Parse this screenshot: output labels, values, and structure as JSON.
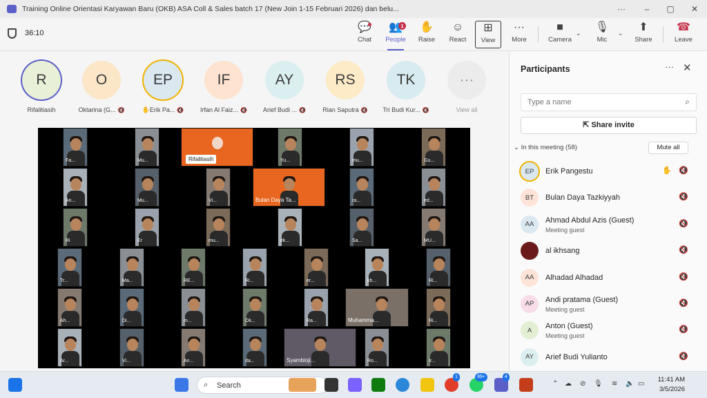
{
  "window": {
    "title": "Training Online Orientasi Karyawan Baru (OKB) ASA Coll & Sales batch 17 (New Join 1-15 Februari 2026) dan belu...",
    "more_label": "···",
    "minimize_label": "–",
    "maximize_label": "▢",
    "close_label": "✕"
  },
  "toolbar": {
    "timer": "36:10",
    "buttons": [
      {
        "label": "Chat",
        "icon": "chat-icon",
        "glyph": "💬"
      },
      {
        "label": "People",
        "icon": "people-icon",
        "glyph": "👥",
        "badge": "1"
      },
      {
        "label": "Raise",
        "icon": "hand-icon",
        "glyph": "✋"
      },
      {
        "label": "React",
        "icon": "smile-icon",
        "glyph": "☺"
      },
      {
        "label": "View",
        "icon": "grid-icon",
        "glyph": "⊞"
      },
      {
        "label": "More",
        "icon": "ellipsis-icon",
        "glyph": "···"
      },
      {
        "label": "Camera",
        "icon": "camera-icon",
        "glyph": "■"
      },
      {
        "label": "Mic",
        "icon": "mic-off-icon",
        "glyph": "🎙"
      },
      {
        "label": "Share",
        "icon": "share-icon",
        "glyph": "⬆"
      },
      {
        "label": "Leave",
        "icon": "phone-icon",
        "glyph": "☎"
      }
    ],
    "caret": "⌄"
  },
  "avatars": [
    {
      "initials": "R",
      "name": "Rifalitiasih",
      "bg": "#e8f0d8",
      "muted": false
    },
    {
      "initials": "O",
      "name": "Oktarina (G...",
      "bg": "#fbe7c8",
      "muted": true
    },
    {
      "initials": "EP",
      "name": "Erik Pa...",
      "bg": "#dbe8f0",
      "muted": true,
      "hand": "✋"
    },
    {
      "initials": "IF",
      "name": "Irfan Al Faiz...",
      "bg": "#fde3d0",
      "muted": true
    },
    {
      "initials": "AY",
      "name": "Arief Budi ...",
      "bg": "#dceff0",
      "muted": true
    },
    {
      "initials": "RS",
      "name": "Rian Saputra",
      "bg": "#fdebc8",
      "muted": true
    },
    {
      "initials": "TK",
      "name": "Tri Budi Kur...",
      "bg": "#d7ebf0",
      "muted": true
    },
    {
      "initials": "···",
      "name": "View all",
      "bg": "#ececec",
      "muted": false
    }
  ],
  "mute_glyph": "🔇",
  "gallery": {
    "tiles": [
      "Fa...",
      "Mu...",
      "Yu...",
      "mu...",
      "Gu...",
      "An...",
      "Mu...",
      "Vi...",
      "ra...",
      "ed...",
      "Ri",
      "Er",
      "mu...",
      "ek...",
      "Sa...",
      "MU...",
      "Tr...",
      "Ma...",
      "RE...",
      "Ri...",
      "er...",
      "kh...",
      "Ri...",
      "Ah...",
      "Di...",
      "m...",
      "Ok...",
      "Ra...",
      "Ri...",
      "Ar...",
      "Vi...",
      "An...",
      "da...",
      "Ro...",
      "Ir..."
    ],
    "wide_tiles": [
      "Bulan Daya Ta...",
      "Muhamma...",
      "Syambioji..."
    ],
    "pinned_label": "Rifalitiasih"
  },
  "panel": {
    "title": "Participants",
    "more_glyph": "···",
    "close_glyph": "✕",
    "search_placeholder": "Type a name",
    "share_invite": "Share invite",
    "section": "In this meeting (58)",
    "mute_all": "Mute all",
    "participants": [
      {
        "initials": "EP",
        "name": "Erik Pangestu",
        "sub": "",
        "bg": "#dbe8f0",
        "hand": true
      },
      {
        "initials": "BT",
        "name": "Bulan Daya Tazkiyyah",
        "sub": "",
        "bg": "#fde3d8",
        "hand": false
      },
      {
        "initials": "AA",
        "name": "Ahmad Abdul Azis (Guest)",
        "sub": "Meeting guest",
        "bg": "#dbe8f0",
        "hand": false
      },
      {
        "initials": "",
        "name": "al ikhsang",
        "sub": "",
        "bg": "#6b1a1a",
        "hand": false
      },
      {
        "initials": "AA",
        "name": "Alhadad Alhadad",
        "sub": "",
        "bg": "#fde3d8",
        "hand": false
      },
      {
        "initials": "AP",
        "name": "Andi pratama (Guest)",
        "sub": "Meeting guest",
        "bg": "#f8dde8",
        "hand": false
      },
      {
        "initials": "A",
        "name": "Anton (Guest)",
        "sub": "Meeting guest",
        "bg": "#e2efd3",
        "hand": false
      },
      {
        "initials": "AY",
        "name": "Arief Budi Yulianto",
        "sub": "",
        "bg": "#dceff0",
        "hand": false
      }
    ]
  },
  "taskbar": {
    "search_label": "Search",
    "badge_whatsapp": "99+",
    "badge_teams": "4",
    "badge_chrome": "1",
    "time": "11:41 AM",
    "date": "3/5/2026"
  }
}
